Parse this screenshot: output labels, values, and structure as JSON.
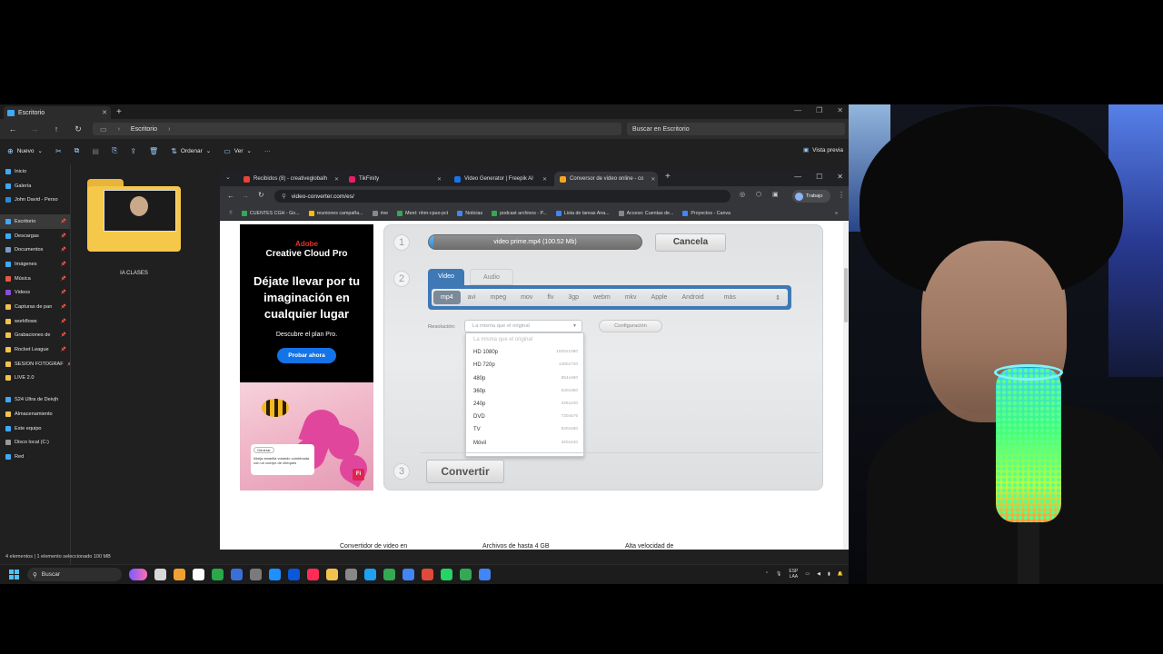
{
  "explorer": {
    "tab_title": "Escritorio",
    "breadcrumb": "Escritorio",
    "search_placeholder": "Buscar en Escritorio",
    "commands": {
      "new": "Nuevo",
      "sort": "Ordenar",
      "view": "Ver",
      "more": "···",
      "preview": "Vista previa"
    },
    "sidebar": [
      {
        "label": "Inicio",
        "color": "#3fa9f5"
      },
      {
        "label": "Galería",
        "color": "#3fa9f5"
      },
      {
        "label": "John David - Perso",
        "color": "#2b88d8"
      },
      {
        "label": "Escritorio",
        "color": "#3fa9f5",
        "selected": true
      },
      {
        "label": "Descargas",
        "color": "#3fa9f5"
      },
      {
        "label": "Documentos",
        "color": "#7a9cc6"
      },
      {
        "label": "Imágenes",
        "color": "#3fa9f5"
      },
      {
        "label": "Música",
        "color": "#e05a47"
      },
      {
        "label": "Videos",
        "color": "#8a4fd6"
      },
      {
        "label": "Capturas de pan",
        "color": "#f2c14e"
      },
      {
        "label": "workflows",
        "color": "#f2c14e"
      },
      {
        "label": "Grabaciones de",
        "color": "#f2c14e"
      },
      {
        "label": "Rocket League",
        "color": "#f2c14e"
      },
      {
        "label": "SESION FOTOGRAF",
        "color": "#f2c14e"
      },
      {
        "label": "LIVE 2.0",
        "color": "#f2c14e"
      },
      {
        "label": "S24 Ultra de Deivjh",
        "color": "#3fa9f5"
      },
      {
        "label": "Almacenamiento",
        "color": "#f2c14e"
      },
      {
        "label": "Este equipo",
        "color": "#3fa9f5"
      },
      {
        "label": "Disco local (C:)",
        "color": "#9a9a9a"
      },
      {
        "label": "Red",
        "color": "#3fa9f5"
      }
    ],
    "folder_label": "IA CLASES",
    "status": "4 elementos  |  1 elemento seleccionado  100 MB"
  },
  "browser": {
    "tabs": [
      {
        "title": "Recibidos (8) - creativeglobalh",
        "color": "#ea4335"
      },
      {
        "title": "TikFinity",
        "color": "#e91e63"
      },
      {
        "title": "Video Generator | Freepik AI",
        "color": "#1a73e8"
      },
      {
        "title": "Conversor de video online - co",
        "color": "#f5a623",
        "active": true
      }
    ],
    "url": "video-converter.com/es/",
    "profile": "Trabajo",
    "bookmarks": [
      {
        "label": "CUENTES CGH - Go...",
        "color": "#34a853"
      },
      {
        "label": "reuniones campaña...",
        "color": "#fbbc04"
      },
      {
        "label": "rive",
        "color": "#888888"
      },
      {
        "label": "Meet: nhm-cpuo-pct",
        "color": "#34a853"
      },
      {
        "label": "Noticias",
        "color": "#4285f4"
      },
      {
        "label": "podcast archivos - P...",
        "color": "#34a853"
      },
      {
        "label": "Lista de tareas Ana...",
        "color": "#4285f4"
      },
      {
        "label": "Acceso: Cuentas de...",
        "color": "#888888"
      },
      {
        "label": "Proyectos - Canva",
        "color": "#4285f4"
      }
    ]
  },
  "ad": {
    "brand": "Adobe",
    "product": "Creative Cloud Pro",
    "headline": "Déjate llevar por tu imaginación en cualquier lugar",
    "sub": "Descubre el plan Pro.",
    "cta": "Probar ahora",
    "card_tag": "Generar",
    "card_text": "Abeja amarilla volando combinada con un cuerpo de cheques",
    "badge": "Fi"
  },
  "converter": {
    "step1": "1",
    "step2": "2",
    "step3": "3",
    "file": "video prime.mp4 (100.52 Mb)",
    "progress": 0.02,
    "cancel": "Cancela",
    "tab_video": "Video",
    "tab_audio": "Audio",
    "formats": [
      "mp4",
      "avi",
      "mpeg",
      "mov",
      "flv",
      "3gp",
      "webm",
      "mkv",
      "Apple",
      "Android",
      "más"
    ],
    "selected_format": "mp4",
    "resolution_label": "Resolución:",
    "resolution_value": "La misma que el original",
    "config": "Configuración",
    "resolutions": [
      {
        "name": "La misma que el original",
        "dim": ""
      },
      {
        "name": "HD 1080p",
        "dim": "1920x1080"
      },
      {
        "name": "HD 720p",
        "dim": "1280x720"
      },
      {
        "name": "480p",
        "dim": "854x480"
      },
      {
        "name": "360p",
        "dim": "640x360"
      },
      {
        "name": "240p",
        "dim": "426x240"
      },
      {
        "name": "DVD",
        "dim": "720x576"
      },
      {
        "name": "TV",
        "dim": "640x480"
      },
      {
        "name": "Móvil",
        "dim": "320x240"
      }
    ],
    "convert": "Convertir"
  },
  "features": [
    "Convertidor de video en",
    "Archivos de hasta 4 GB",
    "Alta velocidad de"
  ],
  "taskbar": {
    "search": "Buscar",
    "lang": "ESP",
    "region": "LAA"
  }
}
